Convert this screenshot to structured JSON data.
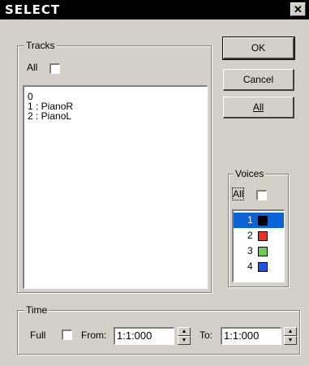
{
  "window": {
    "title": "SELECT",
    "close_glyph": "✕"
  },
  "buttons": {
    "ok": "OK",
    "cancel": "Cancel",
    "all": "All"
  },
  "tracks": {
    "legend": "Tracks",
    "all_label": "All",
    "all_checked": false,
    "items": [
      "0",
      "1 : PianoR",
      "2 : PianoL"
    ]
  },
  "voices": {
    "legend": "Voices",
    "all_label": "All",
    "all_checked": false,
    "items": [
      {
        "label": "1",
        "color": "#000000",
        "selected": true
      },
      {
        "label": "2",
        "color": "#e8341a",
        "selected": false
      },
      {
        "label": "3",
        "color": "#6ed04a",
        "selected": false
      },
      {
        "label": "4",
        "color": "#1a55e8",
        "selected": false
      }
    ]
  },
  "time": {
    "legend": "Time",
    "full_label": "Full",
    "full_checked": false,
    "from_label": "From:",
    "from_value": "1:1:000",
    "to_label": "To:",
    "to_value": "1:1:000"
  }
}
